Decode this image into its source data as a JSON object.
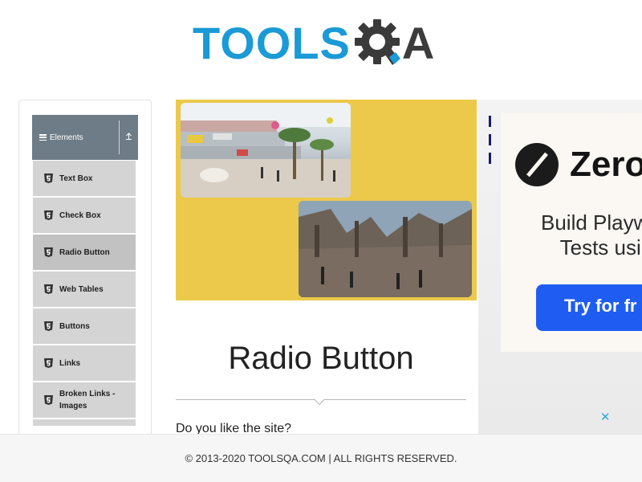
{
  "logo": {
    "text_left": "TOOLS",
    "text_right": "A",
    "brand": "TOOLSQA"
  },
  "sidebar": {
    "group_label": "Elements",
    "items": [
      {
        "label": "Text Box",
        "icon": "html5-icon"
      },
      {
        "label": "Check Box",
        "icon": "html5-icon"
      },
      {
        "label": "Radio Button",
        "icon": "html5-icon",
        "active": true
      },
      {
        "label": "Web Tables",
        "icon": "html5-icon"
      },
      {
        "label": "Buttons",
        "icon": "html5-icon"
      },
      {
        "label": "Links",
        "icon": "html5-icon"
      },
      {
        "label": "Broken Links - Images",
        "icon": "html5-icon"
      }
    ]
  },
  "ad": {
    "brand": "Zero",
    "headline_line1": "Build Playw",
    "headline_line2": "Tests usi",
    "cta": "Try for fr",
    "close_icon": "close-icon"
  },
  "main": {
    "title": "Radio Button",
    "question": "Do you like the site?"
  },
  "footer": {
    "text": "© 2013-2020 TOOLSQA.COM | ALL RIGHTS RESERVED."
  },
  "colors": {
    "brand_blue": "#1a9ad6",
    "sidebar_header": "#6e7c87",
    "menu_item": "#d4d4d4",
    "banner_bg": "#ecc94b",
    "ad_cta": "#1f5df2"
  }
}
